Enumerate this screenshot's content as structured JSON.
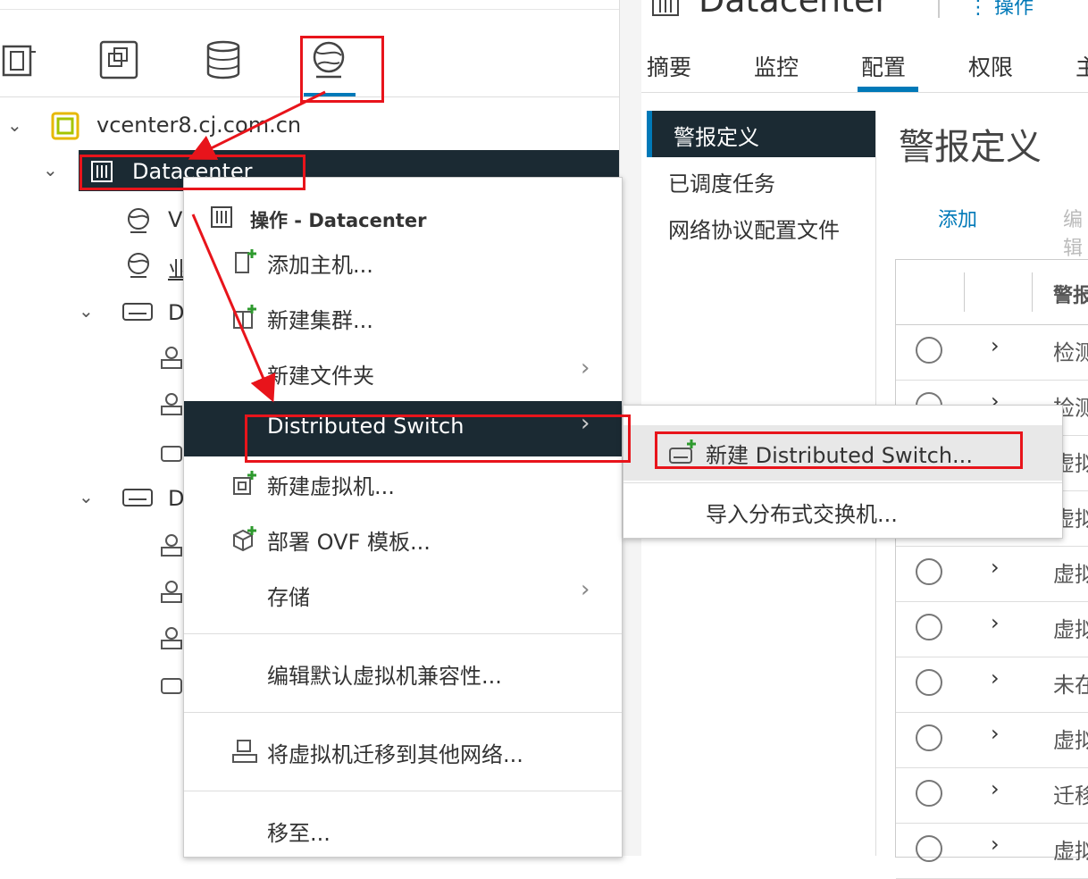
{
  "colors": {
    "accent": "#0079b8",
    "dark": "#1b2a33",
    "annotation": "#e8141b",
    "plus": "#2e9a2e"
  },
  "navigator": {
    "tabs": [
      {
        "icon": "hosts-clusters-icon"
      },
      {
        "icon": "vms-templates-icon"
      },
      {
        "icon": "storage-icon"
      },
      {
        "icon": "networking-icon"
      }
    ],
    "tree": {
      "vcenter": "vcenter8.cj.com.cn",
      "datacenter": "Datacenter",
      "child1": "V",
      "child2": "业",
      "child3": "D",
      "child4": "D"
    }
  },
  "header": {
    "title": "Datacenter",
    "actions": "操作"
  },
  "tabs": [
    "摘要",
    "监控",
    "配置",
    "权限",
    "主"
  ],
  "config_nav": [
    "警报定义",
    "已调度任务",
    "网络协议配置文件"
  ],
  "panel": {
    "title": "警报定义",
    "add": "添加",
    "edit": "编辑",
    "column": "警报"
  },
  "alarm_rows": [
    "检测",
    "检测",
    "虚拟",
    "虚拟",
    "虚拟",
    "虚拟",
    "未在",
    "虚拟",
    "迁移",
    "虚拟"
  ],
  "context_menu": {
    "header": "操作 - Datacenter",
    "items": [
      {
        "label": "添加主机..."
      },
      {
        "label": "新建集群..."
      },
      {
        "label": "新建文件夹"
      },
      {
        "label": "Distributed Switch"
      },
      {
        "label": "新建虚拟机..."
      },
      {
        "label": "部署 OVF 模板..."
      },
      {
        "label": "存储"
      },
      {
        "label": "编辑默认虚拟机兼容性..."
      },
      {
        "label": "将虚拟机迁移到其他网络..."
      },
      {
        "label": "移至..."
      }
    ]
  },
  "submenu": {
    "items": [
      "新建 Distributed Switch...",
      "导入分布式交换机..."
    ]
  }
}
